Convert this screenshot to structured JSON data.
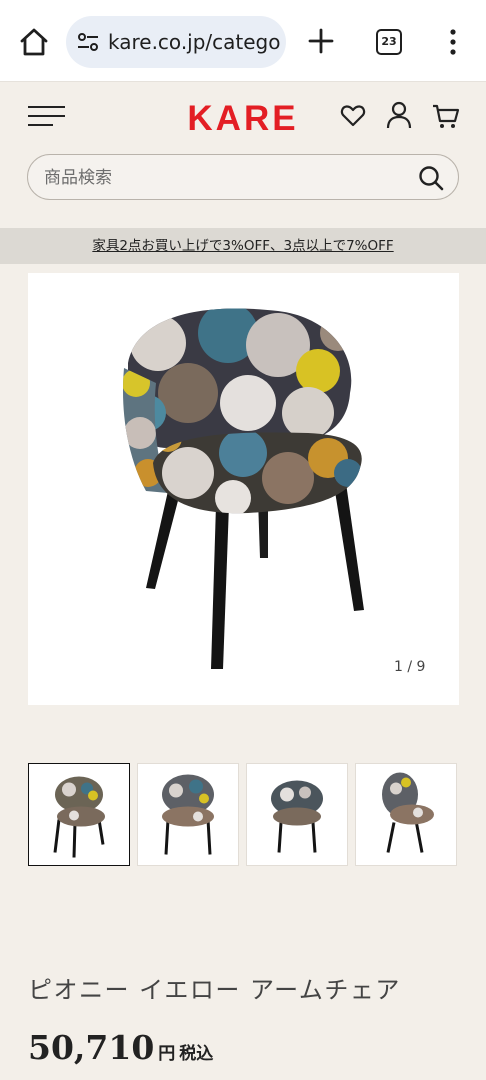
{
  "browser": {
    "url": "kare.co.jp/catego",
    "tab_count": "23"
  },
  "header": {
    "logo_text": "KARE",
    "brand_color": "#e31e24"
  },
  "search": {
    "placeholder": "商品検索"
  },
  "promo": {
    "text": "家具2点お買い上げで3%OFF、3点以上で7%OFF"
  },
  "gallery": {
    "counter": "1 / 9",
    "thumbnails": [
      "thumbnail-1",
      "thumbnail-2",
      "thumbnail-3",
      "thumbnail-4"
    ],
    "active_index": 0
  },
  "product": {
    "title": "ピオニー イエロー アームチェア",
    "price": "50,710",
    "price_unit": "円",
    "tax_label": "税込"
  }
}
